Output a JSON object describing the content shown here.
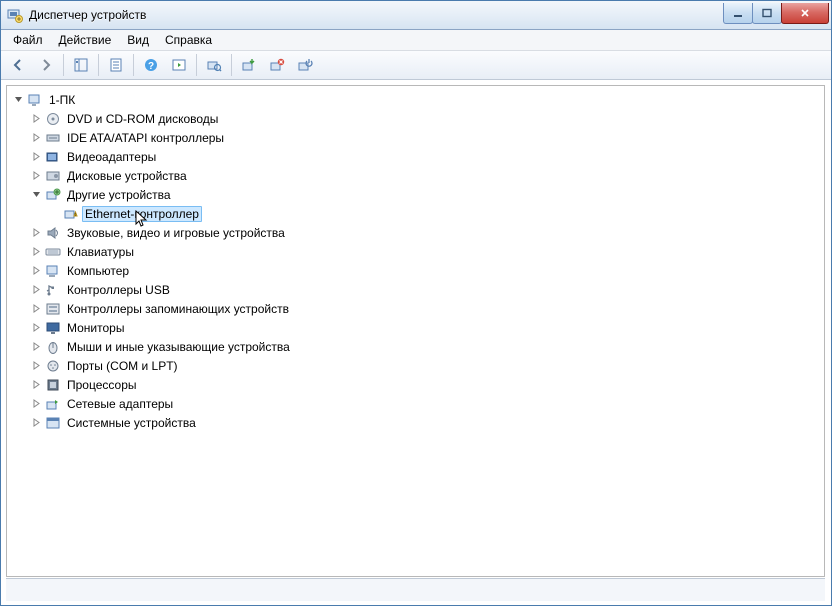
{
  "window": {
    "title": "Диспетчер устройств"
  },
  "menu": {
    "file": "Файл",
    "action": "Действие",
    "view": "Вид",
    "help": "Справка"
  },
  "icons": {
    "computer": "<rect x='2' y='3' width='10' height='8' fill='#d7e4f3' stroke='#5a82b4'/><rect x='5' y='12' width='4' height='2' fill='#9aa9ba'/>",
    "dvd": "<circle cx='8' cy='8' r='5.5' fill='#e9edf2' stroke='#7d8b9c'/><circle cx='8' cy='8' r='1.5' fill='#7d8b9c'/>",
    "ide": "<rect x='2' y='5' width='12' height='6' fill='#cfd8e3' stroke='#6d7c8e'/><line x1='4' y1='8' x2='12' y2='8' stroke='#6d7c8e'/>",
    "video": "<rect x='2' y='4' width='10' height='8' fill='#3f6aa0' stroke='#2d4c77'/><rect x='3' y='5' width='8' height='6' fill='#8fb4e2'/>",
    "disk": "<rect x='2' y='4' width='12' height='8' fill='#cfd8e3' stroke='#6d7c8e'/><circle cx='11' cy='8' r='2' fill='#8b97a7'/>",
    "other": "<rect x='2' y='5' width='9' height='7' fill='#d7e4f3' stroke='#5a82b4'/><circle cx='12' cy='5' r='3' fill='#8ecb8e' stroke='#4e9a4e'/><path d='M12 3v4M10 5h4' stroke='#2e6b2e'/>",
    "warn": "<rect x='2' y='5' width='9' height='7' fill='#d7e4f3' stroke='#5a82b4'/><path d='M11 10 L14 10 L12.5 6 Z' fill='#ffd24a' stroke='#b38f1c'/><line x1='12.5' y1='7.2' x2='12.5' y2='8.6' stroke='#6b5410'/><circle cx='12.5' cy='9.4' r='.5' fill='#6b5410'/>",
    "sound": "<path d='M3 6h3l4-3v10l-4-3H3z' fill='#9aa9ba' stroke='#6d7c8e'/><path d='M11 5c2 2 2 4 0 6' fill='none' stroke='#6d7c8e'/>",
    "keyboard": "<rect x='1' y='5' width='14' height='6' rx='1' fill='#e3e7ed' stroke='#7d8b9c'/><line x1='3' y1='7' x2='13' y2='7' stroke='#9aa9ba'/><line x1='3' y1='9' x2='13' y2='9' stroke='#9aa9ba'/>",
    "pc": "<rect x='2' y='3' width='10' height='8' fill='#d7e4f3' stroke='#5a82b4'/><rect x='4' y='12' width='6' height='2' fill='#9aa9ba'/>",
    "usb": "<circle cx='4' cy='12' r='1.5' fill='#6d7c8e'/><path d='M4 12V4l4 2M4 8l-2 1' stroke='#6d7c8e' fill='none' stroke-width='1.3'/><rect x='6.5' y='4.5' width='2.5' height='2.5' fill='#6d7c8e'/>",
    "storage": "<rect x='2' y='3' width='12' height='10' fill='#e3e7ed' stroke='#6d7c8e'/><rect x='4' y='5' width='8' height='2' fill='#9aa9ba'/><rect x='4' y='9' width='8' height='2' fill='#9aa9ba'/>",
    "monitor": "<rect x='2' y='3' width='12' height='8' fill='#3f6aa0' stroke='#2d4c77'/><rect x='6' y='12' width='4' height='2' fill='#6d7c8e'/>",
    "mouse": "<ellipse cx='8' cy='9' rx='4' ry='5.5' fill='#e3e7ed' stroke='#6d7c8e'/><line x1='8' y1='3.5' x2='8' y2='9' stroke='#6d7c8e'/>",
    "port": "<circle cx='8' cy='8' r='5' fill='#e3e7ed' stroke='#6d7c8e'/><circle cx='6' cy='7' r='.8' fill='#6d7c8e'/><circle cx='10' cy='7' r='.8' fill='#6d7c8e'/><circle cx='8' cy='10' r='.8' fill='#6d7c8e'/>",
    "cpu": "<rect x='3' y='3' width='10' height='10' fill='#6d7c8e' stroke='#3f4a57'/><rect x='5' y='5' width='6' height='6' fill='#c8d1dc'/>",
    "net": "<rect x='2' y='6' width='9' height='7' fill='#d7e4f3' stroke='#5a82b4'/><path d='M10 4l3 2-3 2' fill='#3c9b3c'/>",
    "system": "<rect x='2' y='3' width='12' height='10' fill='#d7e4f3' stroke='#5a82b4'/><rect x='2' y='3' width='12' height='3' fill='#5a82b4'/>"
  },
  "tree": {
    "label": "1-ПК",
    "icon": "computer",
    "expanded": true,
    "children": [
      {
        "label": "DVD и CD-ROM дисководы",
        "icon": "dvd"
      },
      {
        "label": "IDE ATA/ATAPI контроллеры",
        "icon": "ide"
      },
      {
        "label": "Видеоадаптеры",
        "icon": "video"
      },
      {
        "label": "Дисковые устройства",
        "icon": "disk"
      },
      {
        "label": "Другие устройства",
        "icon": "other",
        "expanded": true,
        "children": [
          {
            "label": "Ethernet-контроллер",
            "icon": "warn",
            "leaf": true,
            "selected": true
          }
        ]
      },
      {
        "label": "Звуковые, видео и игровые устройства",
        "icon": "sound"
      },
      {
        "label": "Клавиатуры",
        "icon": "keyboard"
      },
      {
        "label": "Компьютер",
        "icon": "pc"
      },
      {
        "label": "Контроллеры USB",
        "icon": "usb"
      },
      {
        "label": "Контроллеры запоминающих устройств",
        "icon": "storage"
      },
      {
        "label": "Мониторы",
        "icon": "monitor"
      },
      {
        "label": "Мыши и иные указывающие устройства",
        "icon": "mouse"
      },
      {
        "label": "Порты (COM и LPT)",
        "icon": "port"
      },
      {
        "label": "Процессоры",
        "icon": "cpu"
      },
      {
        "label": "Сетевые адаптеры",
        "icon": "net"
      },
      {
        "label": "Системные устройства",
        "icon": "system"
      }
    ]
  }
}
